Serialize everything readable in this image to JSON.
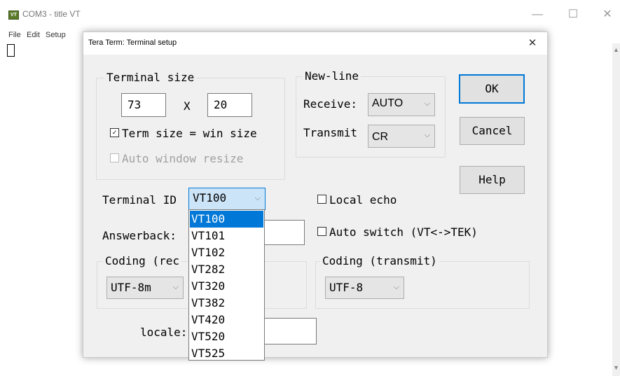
{
  "window": {
    "title": "COM3 - title VT",
    "icon_text": "VT",
    "minimize_glyph": "—",
    "maximize_glyph": "☐",
    "close_glyph": "✕"
  },
  "menu": [
    "File",
    "Edit",
    "Setup"
  ],
  "dialog": {
    "title": "Tera Term: Terminal setup",
    "close_glyph": "✕",
    "terminal_size": {
      "legend": "Terminal size",
      "cols": "73",
      "x_label": "X",
      "rows": "20",
      "term_size_win_size": "Term size = win size",
      "term_size_checked": true,
      "auto_window_resize": "Auto window resize"
    },
    "new_line": {
      "legend": "New-line",
      "receive_label": "Receive:",
      "receive_value": "AUTO",
      "transmit_label": "Transmit",
      "transmit_value": "CR"
    },
    "buttons": {
      "ok": "OK",
      "cancel": "Cancel",
      "help": "Help"
    },
    "terminal_id_label": "Terminal ID",
    "terminal_id_value": "VT100",
    "terminal_id_options": [
      "VT100",
      "VT101",
      "VT102",
      "VT282",
      "VT320",
      "VT382",
      "VT420",
      "VT520",
      "VT525"
    ],
    "terminal_id_selected_index": 0,
    "local_echo": "Local echo",
    "answerback_label": "Answerback:",
    "auto_switch": "Auto switch (VT<->TEK)",
    "coding_receive_legend": "Coding (rec",
    "coding_receive_value": "UTF-8m",
    "coding_transmit_legend": "Coding (transmit)",
    "coding_transmit_value": "UTF-8",
    "locale_label": "locale:"
  },
  "colors": {
    "accent": "#0078d7",
    "dialog_bg": "#f0f0f0"
  }
}
